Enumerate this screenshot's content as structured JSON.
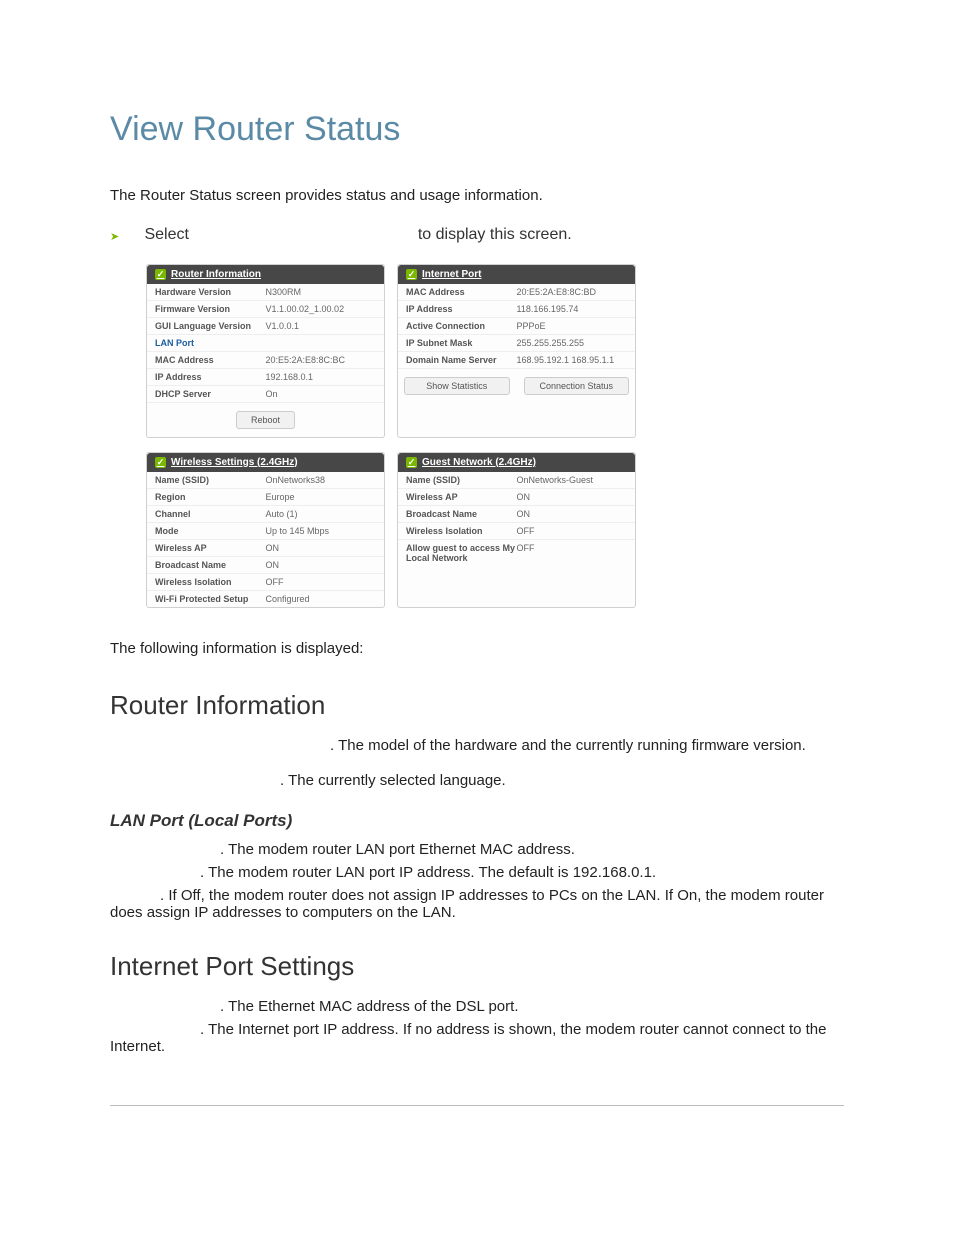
{
  "title": "View Router Status",
  "intro": "The Router Status screen provides status and usage information.",
  "selectLine": {
    "left": "Select",
    "right": "to display this screen."
  },
  "panels": {
    "routerInfo": {
      "title": "Router Information",
      "rows": [
        {
          "k": "Hardware Version",
          "v": "N300RM"
        },
        {
          "k": "Firmware Version",
          "v": "V1.1.00.02_1.00.02"
        },
        {
          "k": "GUI Language Version",
          "v": "V1.0.0.1"
        }
      ],
      "lanLabel": "LAN Port",
      "lanRows": [
        {
          "k": "MAC Address",
          "v": "20:E5:2A:E8:8C:BC"
        },
        {
          "k": "IP Address",
          "v": "192.168.0.1"
        },
        {
          "k": "DHCP Server",
          "v": "On"
        }
      ],
      "rebootBtn": "Reboot"
    },
    "internetPort": {
      "title": "Internet Port",
      "rows": [
        {
          "k": "MAC Address",
          "v": "20:E5:2A:E8:8C:BD"
        },
        {
          "k": "IP Address",
          "v": "118.166.195.74"
        },
        {
          "k": "Active Connection",
          "v": "PPPoE"
        },
        {
          "k": "IP Subnet Mask",
          "v": "255.255.255.255"
        },
        {
          "k": "Domain Name Server",
          "v": "168.95.192.1 168.95.1.1"
        }
      ],
      "btns": {
        "stats": "Show Statistics",
        "conn": "Connection Status"
      }
    },
    "wireless": {
      "title": "Wireless Settings (2.4GHz)",
      "rows": [
        {
          "k": "Name (SSID)",
          "v": "OnNetworks38"
        },
        {
          "k": "Region",
          "v": "Europe"
        },
        {
          "k": "Channel",
          "v": "Auto (1)"
        },
        {
          "k": "Mode",
          "v": "Up to 145 Mbps"
        },
        {
          "k": "Wireless AP",
          "v": "ON"
        },
        {
          "k": "Broadcast Name",
          "v": "ON"
        },
        {
          "k": "Wireless Isolation",
          "v": "OFF"
        },
        {
          "k": "Wi-Fi Protected Setup",
          "v": "Configured"
        }
      ]
    },
    "guest": {
      "title": "Guest Network (2.4GHz)",
      "rows": [
        {
          "k": "Name (SSID)",
          "v": "OnNetworks-Guest"
        },
        {
          "k": "Wireless AP",
          "v": "ON"
        },
        {
          "k": "Broadcast Name",
          "v": "ON"
        },
        {
          "k": "Wireless Isolation",
          "v": "OFF"
        },
        {
          "k": "Allow guest to access My Local Network",
          "v": "OFF"
        }
      ]
    }
  },
  "followingInfo": "The following information is displayed:",
  "sections": {
    "routerInfo": {
      "heading": "Router Information",
      "line1": ". The model of the hardware and the currently running firmware version.",
      "line2": ". The currently selected language."
    },
    "lanPort": {
      "heading": "LAN Port (Local Ports)",
      "mac": ". The modem router LAN port Ethernet MAC address.",
      "ip": ". The modem router LAN port IP address. The default is 192.168.0.1.",
      "dhcp": ". If Off, the modem router does not assign IP addresses to PCs on the LAN. If On, the modem router does assign IP addresses to computers on the LAN."
    },
    "internet": {
      "heading": "Internet Port Settings",
      "mac": ". The Ethernet MAC address of the DSL port.",
      "ip": ". The Internet port IP address. If no address is shown, the modem router cannot connect to the Internet."
    }
  }
}
